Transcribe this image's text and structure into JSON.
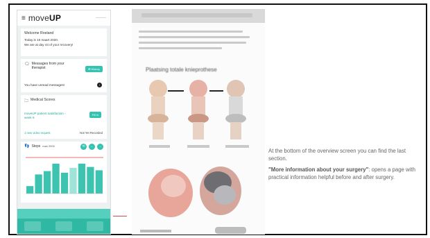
{
  "app": {
    "logo_prefix": "move",
    "logo_suffix": "UP",
    "menu_icon": "menu-icon",
    "header_mini": "———"
  },
  "welcome": {
    "greeting": "Welcome Roeland",
    "today_line": "Today is 16 maart 2020.",
    "recovery_line": "We are at day 44 of your recovery!"
  },
  "messages": {
    "title": "Messages from your therapist",
    "history_button": "History",
    "unread_text": "You have unread messages!",
    "unread_badge": "!"
  },
  "medical": {
    "title": "Medical Scores",
    "survey_name": "moveUP patient satisfaction - week 6",
    "fill_button": "Fill in",
    "video_request": "1 new video request",
    "not_recorded": "Not Yet Recorded"
  },
  "steps": {
    "label": "Steps",
    "max_label": "max 2000",
    "nav_refresh": "⟲",
    "nav_prev": "←",
    "nav_next": "→"
  },
  "chart_data": {
    "type": "bar",
    "values": [
      450,
      1150,
      1350,
      1800,
      1250,
      1550,
      1800,
      1600,
      1400
    ]
  },
  "colors": {
    "teal": "#34c3b0",
    "teal_dark": "#2fb9a5",
    "connector_red": "#dd4444"
  },
  "document": {
    "heading": "Plaatsing totale knieprothese"
  },
  "caption": {
    "para1": "At the bottom of the overview screen you can find the last section.",
    "para2_bold": "\"More information about your surgery\"",
    "para2_rest": ": opens a page with practical information helpful before and after surgery."
  }
}
